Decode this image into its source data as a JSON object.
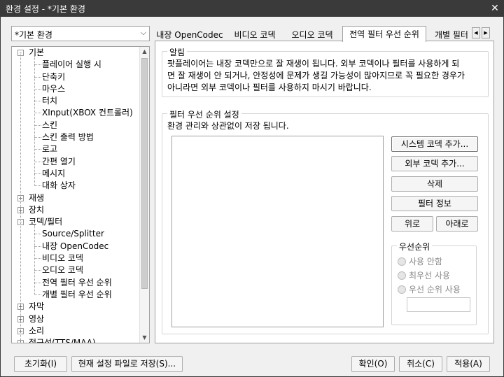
{
  "window": {
    "title": "환경 설정 - *기본 환경",
    "close_glyph": "✕"
  },
  "profile_combo": {
    "value": "*기본 환경"
  },
  "tree": {
    "items": [
      {
        "label": "기본",
        "level": 0,
        "expander": "-"
      },
      {
        "label": "플레이어 실행 시",
        "level": 1
      },
      {
        "label": "단축키",
        "level": 1
      },
      {
        "label": "마우스",
        "level": 1
      },
      {
        "label": "터치",
        "level": 1
      },
      {
        "label": "XInput(XBOX 컨트롤러)",
        "level": 1
      },
      {
        "label": "스킨",
        "level": 1
      },
      {
        "label": "스킨 출력 방법",
        "level": 1
      },
      {
        "label": "로고",
        "level": 1
      },
      {
        "label": "간편 열기",
        "level": 1
      },
      {
        "label": "메시지",
        "level": 1
      },
      {
        "label": "대화 상자",
        "level": 1
      },
      {
        "label": "재생",
        "level": 0,
        "expander": "+"
      },
      {
        "label": "장치",
        "level": 0,
        "expander": "+"
      },
      {
        "label": "코덱/필터",
        "level": 0,
        "expander": "-"
      },
      {
        "label": "Source/Splitter",
        "level": 1
      },
      {
        "label": "내장 OpenCodec",
        "level": 1
      },
      {
        "label": "비디오 코덱",
        "level": 1
      },
      {
        "label": "오디오 코덱",
        "level": 1
      },
      {
        "label": "전역 필터 우선 순위",
        "level": 1
      },
      {
        "label": "개별 필터 우선 순위",
        "level": 1
      },
      {
        "label": "자막",
        "level": 0,
        "expander": "+"
      },
      {
        "label": "영상",
        "level": 0,
        "expander": "+"
      },
      {
        "label": "소리",
        "level": 0,
        "expander": "+"
      },
      {
        "label": "접근성(TTS/MAA)",
        "level": 0,
        "expander": "+"
      }
    ]
  },
  "tabs": [
    {
      "label": "내장 OpenCodec",
      "active": false
    },
    {
      "label": "비디오 코덱",
      "active": false
    },
    {
      "label": "오디오 코덱",
      "active": false
    },
    {
      "label": "전역 필터 우선 순위",
      "active": true
    },
    {
      "label": "개별 필터",
      "active": false
    }
  ],
  "tab_scroll": {
    "left": "◀",
    "right": "▶"
  },
  "notice": {
    "title": "알림",
    "lines": [
      "팟플레이어는 내장 코덱만으로 잘 재생이 됩니다. 외부 코덱이나 필터를 사용하게 되",
      "면 잘 재생이 안 되거나, 안정성에 문제가 생길 가능성이 많아지므로 꼭 필요한 경우가",
      "아니라면 외부 코덱이나 필터를 사용하지 마시기 바랍니다."
    ]
  },
  "filter_priority": {
    "title": "필터 우선 순위 설정",
    "description": "환경 관리와 상관없이 저장 됩니다.",
    "buttons": {
      "add_system": "시스템 코덱 추가...",
      "add_external": "외부 코덱 추가...",
      "delete": "삭제",
      "filter_info": "필터 정보",
      "up": "위로",
      "down": "아래로"
    },
    "priority": {
      "title": "우선순위",
      "options": [
        "사용 안함",
        "최우선 사용",
        "우선 순위 사용"
      ]
    }
  },
  "bottom": {
    "reset": "초기화(I)",
    "save_current": "현재 설정 파일로 저장(S)...",
    "ok": "확인(O)",
    "cancel": "취소(C)",
    "apply": "적용(A)"
  }
}
